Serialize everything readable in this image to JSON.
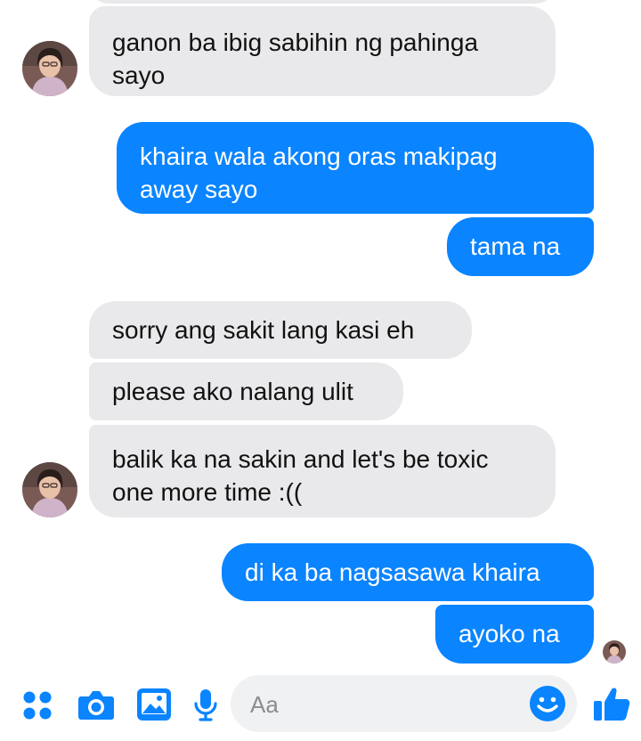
{
  "conversation": {
    "messages": [
      {
        "from": "them",
        "text": "ganon ba ibig sabihin ng pahinga\nsayo"
      },
      {
        "from": "me",
        "text": "khaira wala akong oras makipag\naway sayo"
      },
      {
        "from": "me",
        "text": "tama na"
      },
      {
        "from": "them",
        "text": "sorry ang sakit lang kasi eh"
      },
      {
        "from": "them",
        "text": "please ako nalang ulit"
      },
      {
        "from": "them",
        "text": "balik ka na sakin and let's be toxic\none more time :(("
      },
      {
        "from": "me",
        "text": "di ka ba nagsasawa khaira"
      },
      {
        "from": "me",
        "text": "ayoko na"
      }
    ]
  },
  "composer": {
    "placeholder": "Aa"
  },
  "toolbar": {
    "icons": [
      "more-apps-icon",
      "camera-icon",
      "gallery-icon",
      "microphone-icon",
      "emoji-icon",
      "like-thumb-icon"
    ]
  },
  "colors": {
    "sent_bubble": "#0a84ff",
    "received_bubble": "#e9e9eb",
    "accent": "#0a84ff"
  }
}
